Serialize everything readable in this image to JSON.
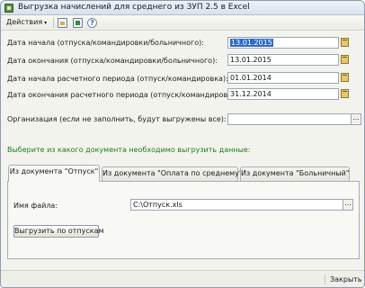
{
  "window": {
    "title": "Выгрузка начислений для среднего из ЗУП 2.5 в Excel"
  },
  "toolbar": {
    "actions_label": "Действия",
    "actions_caret": "▾",
    "help_glyph": "?"
  },
  "form": {
    "fields": [
      {
        "label": "Дата начала (отпуска/командировки/больничного):",
        "value": "13.01.2015",
        "selected": true
      },
      {
        "label": "Дата окончания (отпуска/командировки/больничного):",
        "value": "13.01.2015",
        "selected": false
      },
      {
        "label": "Дата начала расчетного периода (отпуск/командировка):",
        "value": "01.01.2014",
        "selected": false
      },
      {
        "label": "Дата окончания расчетного периода (отпуск/командировка):",
        "value": "31.12.2014",
        "selected": false
      }
    ],
    "organization_label": "Организация (если не заполнить, будут выгружены все):",
    "organization_value": "",
    "dots_glyph": "...",
    "clear_glyph": "×"
  },
  "hint": "Выберите из какого документа необходимо выгрузить данные:",
  "tabs": [
    {
      "label": "Из документа \"Отпуск\"",
      "active": true
    },
    {
      "label": "Из документа \"Оплата по среднему\"",
      "active": false
    },
    {
      "label": "Из документа \"Больничный\"",
      "active": false
    }
  ],
  "panel": {
    "file_label": "Имя файла:",
    "file_value": "C:\\Отпуск.xls",
    "dots_glyph": "...",
    "export_button": "Выгрузить по отпускам"
  },
  "footer": {
    "close_label": "Закрыть"
  }
}
